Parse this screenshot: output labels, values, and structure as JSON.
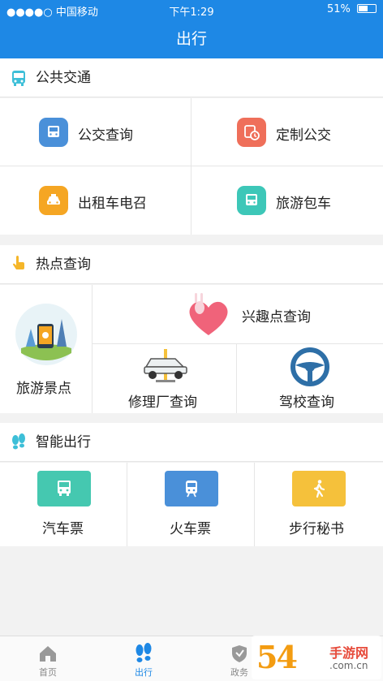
{
  "status_bar": {
    "carrier": "●●●●○ 中国移动",
    "time": "下午1:29",
    "battery": "51%"
  },
  "nav": {
    "title": "出行"
  },
  "public_transit": {
    "title": "公共交通",
    "items": [
      {
        "label": "公交查询",
        "color": "#4a90d9"
      },
      {
        "label": "定制公交",
        "color": "#ef6f5a"
      },
      {
        "label": "出租车电召",
        "color": "#f5a623"
      },
      {
        "label": "旅游包车",
        "color": "#3dc7b8"
      }
    ]
  },
  "hotspots": {
    "title": "热点查询",
    "items": [
      {
        "label": "旅游景点"
      },
      {
        "label": "兴趣点查询"
      },
      {
        "label": "修理厂查询"
      },
      {
        "label": "驾校查询"
      }
    ]
  },
  "smart_travel": {
    "title": "智能出行",
    "items": [
      {
        "label": "汽车票",
        "color": "#45c8b0"
      },
      {
        "label": "火车票",
        "color": "#4a90d9"
      },
      {
        "label": "步行秘书",
        "color": "#f5c13b"
      }
    ]
  },
  "tabs": [
    {
      "label": "首页"
    },
    {
      "label": "出行"
    },
    {
      "label": "政务"
    },
    {
      "label": ""
    }
  ],
  "watermark": {
    "number": "54",
    "text": "手游网",
    "domain": ".com.cn"
  },
  "colors": {
    "primary": "#1e88e5"
  }
}
